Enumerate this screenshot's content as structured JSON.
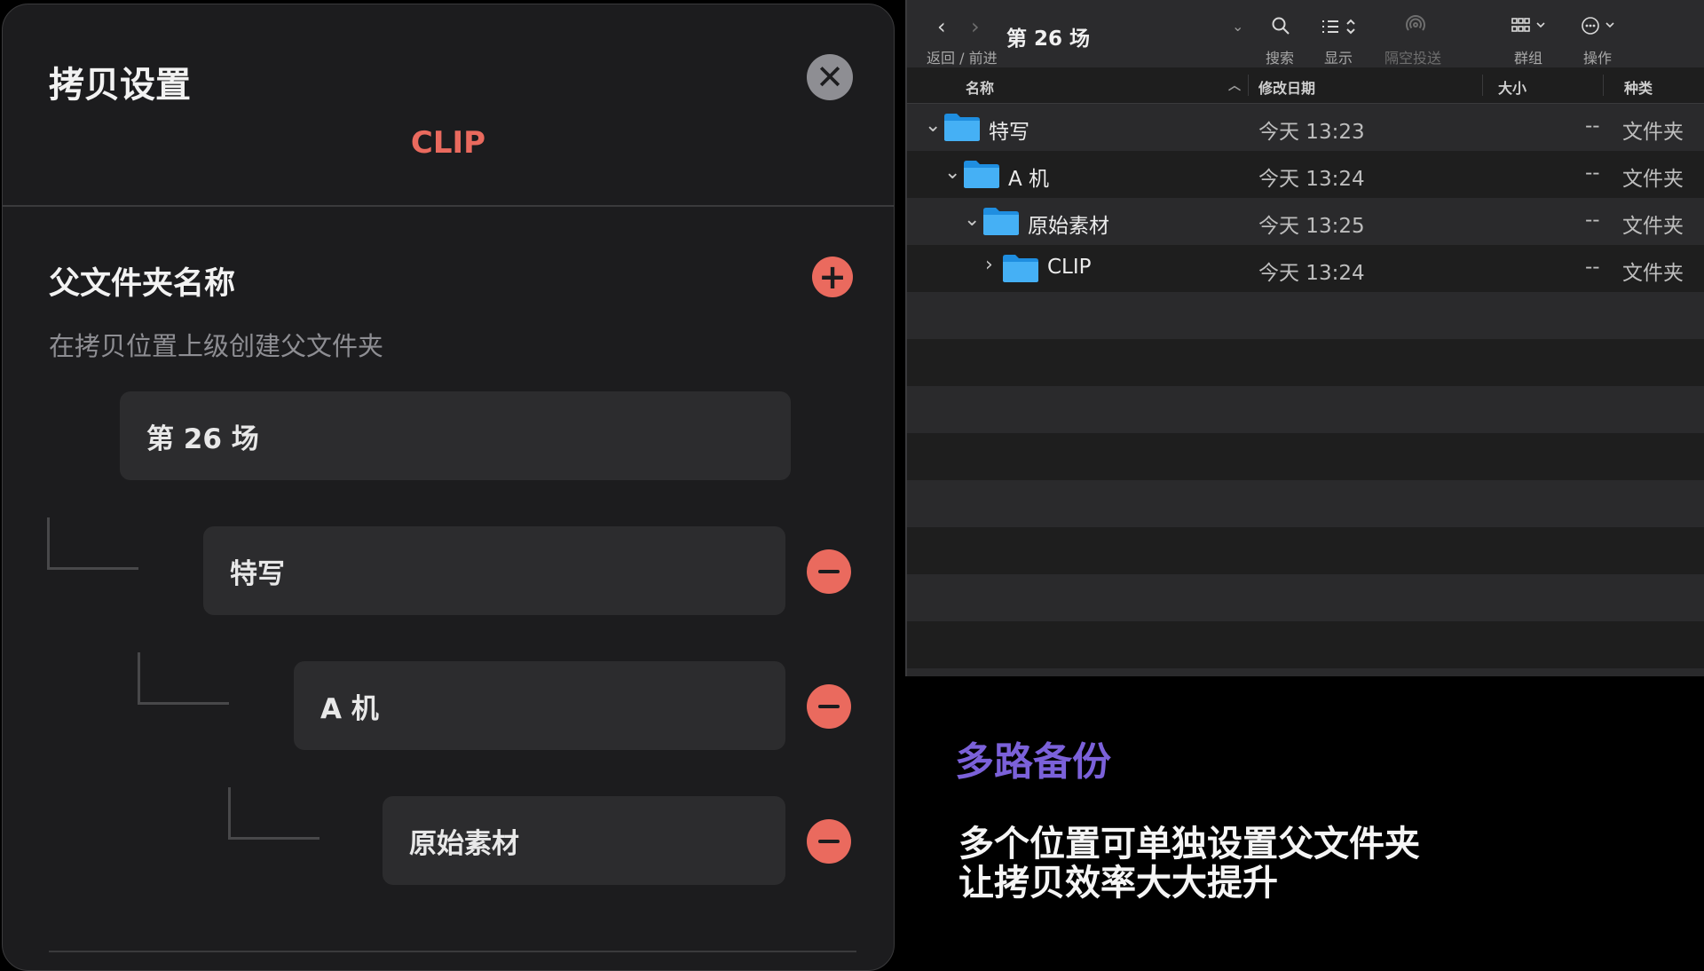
{
  "settings_panel": {
    "title": "拷贝设置",
    "close_icon": "close-icon",
    "clip_label": "CLIP",
    "section_title": "父文件夹名称",
    "add_icon": "plus-icon",
    "section_description": "在拷贝位置上级创建父文件夹",
    "root_folder": "第 26 场",
    "subfolders": [
      {
        "label": "特写",
        "remove_icon": "minus-icon"
      },
      {
        "label": "A 机",
        "remove_icon": "minus-icon"
      },
      {
        "label": "原始素材",
        "remove_icon": "minus-icon"
      }
    ],
    "accent_color": "#ea6a5e"
  },
  "finder": {
    "window_title": "第 26 场",
    "nav_label": "返回 / 前进",
    "toolbar": {
      "search_label": "搜索",
      "view_label": "显示",
      "airdrop_label": "隔空投送",
      "group_label": "群组",
      "action_label": "操作"
    },
    "columns": {
      "name": "名称",
      "date": "修改日期",
      "size": "大小",
      "kind": "种类"
    },
    "rows": [
      {
        "name": "特写",
        "date": "今天 13:23",
        "size": "--",
        "kind": "文件夹",
        "expanded": true
      },
      {
        "name": "A 机",
        "date": "今天 13:24",
        "size": "--",
        "kind": "文件夹",
        "expanded": true
      },
      {
        "name": "原始素材",
        "date": "今天 13:25",
        "size": "--",
        "kind": "文件夹",
        "expanded": true
      },
      {
        "name": "CLIP",
        "date": "今天 13:24",
        "size": "--",
        "kind": "文件夹",
        "expanded": false
      }
    ],
    "folder_color": "#3aa8f0"
  },
  "caption": {
    "title": "多路备份",
    "line1": "多个位置可单独设置父文件夹",
    "line2": "让拷贝效率大大提升",
    "title_color": "#7b61d9"
  }
}
